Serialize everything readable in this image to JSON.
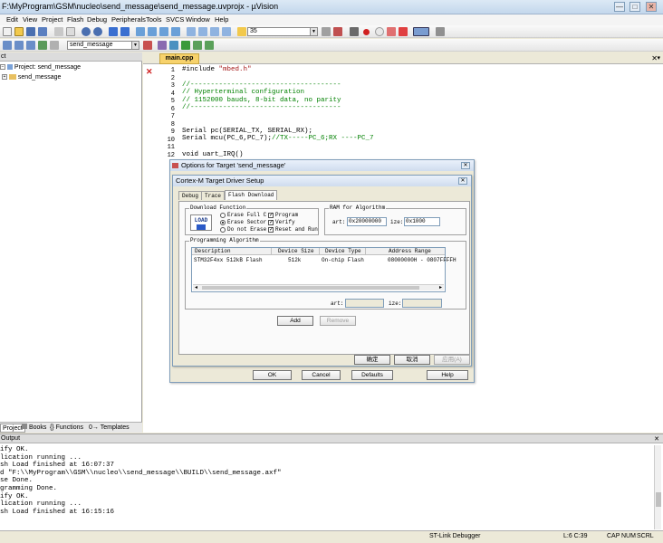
{
  "window": {
    "title": "F:\\MyProgram\\GSM\\nucleo\\send_message\\send_message.uvprojx - µVision",
    "minimize": "—",
    "maximize": "□",
    "close": "✕"
  },
  "menu": [
    "Edit",
    "View",
    "Project",
    "Flash",
    "Debug",
    "Peripherals",
    "Tools",
    "SVCS",
    "Window",
    "Help"
  ],
  "toolbar1": {
    "find_value": "35"
  },
  "toolbar2": {
    "target_select": "send_message"
  },
  "project_pane": {
    "header": "ct",
    "root": "Project: send_message",
    "child": "send_message",
    "tabs": [
      "Project",
      "Books",
      "Functions",
      "Templates"
    ]
  },
  "editor": {
    "file_tab": "main.cpp",
    "line_numbers": [
      "1",
      "2",
      "3",
      "4",
      "5",
      "6",
      "7",
      "8",
      "9",
      "10",
      "11",
      "12",
      "1",
      "1",
      "1",
      "1",
      "1",
      "1",
      "1",
      "2",
      "2",
      "2",
      "2",
      "2",
      "2",
      "2",
      "2",
      "2",
      "3",
      "3",
      "3",
      "3",
      "3",
      "3",
      "3",
      "3"
    ],
    "code": {
      "include": "#include \"mbed.h\"",
      "c1": "//-------------------------------------",
      "c2": "// Hyperterminal configuration",
      "c3": "// 1152000 bauds, 8-bit data, no parity",
      "c4": "//-------------------------------------",
      "serial_pc": "Serial pc(SERIAL_TX, SERIAL_RX);",
      "serial_mcu": "Serial mcu(PC_6,PC_7);",
      "serial_mcu_comment": "//TX-----PC_6;RX ----PC_7",
      "irq": "void uart_IRQ()"
    }
  },
  "options_dialog": {
    "title": "Options for Target 'send_message'",
    "ok": "OK",
    "cancel": "Cancel",
    "defaults": "Defaults",
    "help": "Help"
  },
  "cortex_dialog": {
    "title": "Cortex-M Target Driver Setup",
    "tabs": [
      "Debug",
      "Trace",
      "Flash Download"
    ],
    "download_function": {
      "label": "Download Function",
      "icon_text": "LOAD",
      "erase_full": "Erase Full C",
      "erase_sector": "Erase Sector",
      "no_erase": "Do not Erase",
      "program": "Program",
      "verify": "Verify",
      "reset_run": "Reset and Run",
      "check_mark": "✓"
    },
    "ram": {
      "label": "RAM for Algorithm",
      "start_label": "art:",
      "start_value": "0x20000000",
      "size_label": "ize:",
      "size_value": "0x1000"
    },
    "programming": {
      "label": "Programming Algorithm",
      "columns": [
        "Description",
        "Device Size",
        "Device Type",
        "Address Range"
      ],
      "row": [
        "STM32F4xx 512kB Flash",
        "512k",
        "On-chip Flash",
        "08000000H - 0807FFFFH"
      ],
      "start_label": "art:",
      "size_label": "ize:"
    },
    "add": "Add",
    "remove": "Remove",
    "confirm": "确定",
    "cancel": "取消",
    "apply": "应用(A)"
  },
  "output": {
    "header": "Output",
    "lines": [
      "ify OK.",
      "lication running ...",
      "sh Load finished at 16:07:37",
      "d \"F:\\\\MyProgram\\\\GSM\\\\nucleo\\\\send_message\\\\BUILD\\\\send_message.axf\"",
      "se Done.",
      "gramming Done.",
      "ify OK.",
      "lication running ...",
      "sh Load finished at 16:15:16"
    ]
  },
  "status": {
    "debugger": "ST-Link Debugger",
    "position": "L:6 C:39",
    "cap": "CAP",
    "num": "NUM",
    "scrl": "SCRL"
  },
  "colors": {
    "accent": "#f7d26b",
    "comment": "#008000",
    "string": "#a31515"
  }
}
